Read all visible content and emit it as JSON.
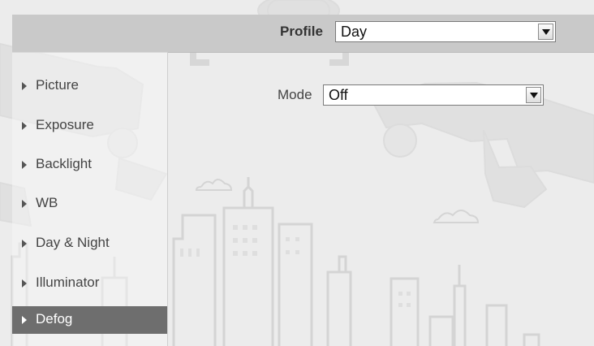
{
  "header": {
    "profile_label": "Profile",
    "profile_value": "Day"
  },
  "sidebar": {
    "items": [
      {
        "label": "Picture",
        "active": false
      },
      {
        "label": "Exposure",
        "active": false
      },
      {
        "label": "Backlight",
        "active": false
      },
      {
        "label": "WB",
        "active": false
      },
      {
        "label": "Day & Night",
        "active": false
      },
      {
        "label": "Illuminator",
        "active": false
      },
      {
        "label": "Defog",
        "active": true
      }
    ]
  },
  "main": {
    "mode_label": "Mode",
    "mode_value": "Off"
  },
  "icons": {
    "nav_marker": "play-icon",
    "dropdown": "chevron-down-icon"
  },
  "colors": {
    "background": "#ececec",
    "header_bar": "#c9c9c9",
    "active_nav": "#6e6e6e",
    "active_text": "#ffffff",
    "text_primary": "#444444"
  }
}
